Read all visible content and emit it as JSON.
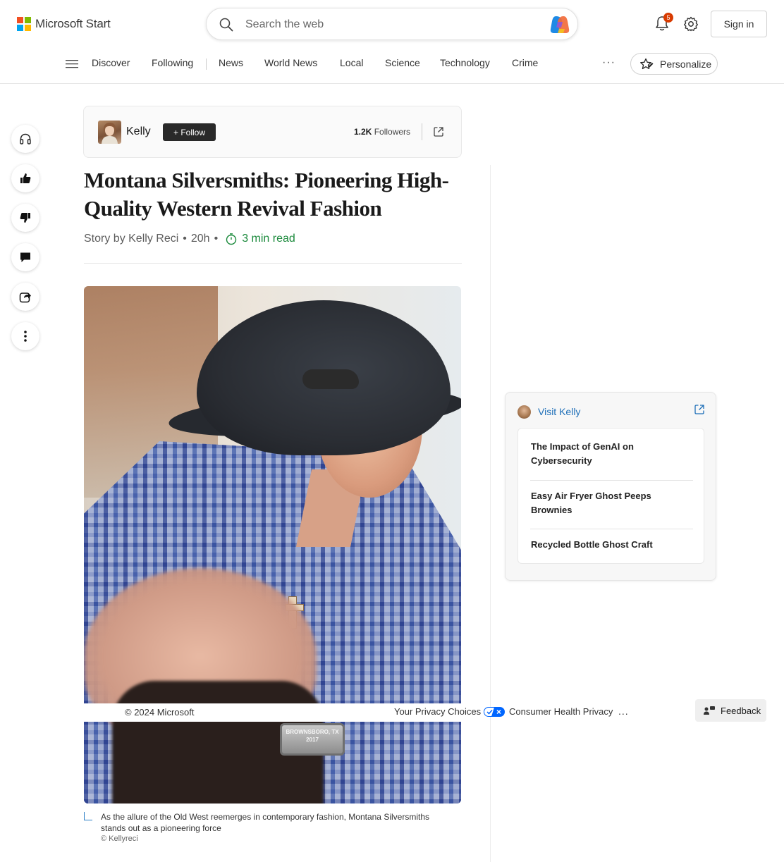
{
  "header": {
    "logo_text": "Microsoft Start",
    "logo_colors": [
      "#f25022",
      "#7fba00",
      "#00a4ef",
      "#ffb900"
    ],
    "search_placeholder": "Search the web",
    "notification_count": "5",
    "sign_in_label": "Sign in"
  },
  "nav": {
    "items": [
      "Discover",
      "Following",
      "News",
      "World News",
      "Local",
      "Science",
      "Technology",
      "Crime"
    ],
    "more_label": "···",
    "personalize_label": "Personalize"
  },
  "rail": {
    "icons": [
      "headphones-icon",
      "thumbs-up-icon",
      "thumbs-down-icon",
      "comment-icon",
      "share-icon",
      "more-vertical-icon"
    ]
  },
  "author_card": {
    "name": "Kelly",
    "follow_label": "Follow",
    "followers_count": "1.2K",
    "followers_label": "Followers"
  },
  "article": {
    "headline": "Montana Silversmiths: Pioneering High-Quality Western Revival Fashion",
    "story_by": "Story by Kelly Reci",
    "age": "20h",
    "read_time": "3 min read",
    "image_buckle_text": "BROWNSBORO, TX 2017",
    "caption": "As the allure of the Old West reemerges in contemporary fashion, Montana Silversmiths stands out as a pioneering force",
    "credit": "© Kellyreci"
  },
  "footer": {
    "copyright": "© 2024 Microsoft",
    "privacy_choices": "Your Privacy Choices",
    "consumer_health": "Consumer Health Privacy",
    "more": "...",
    "feedback_label": "Feedback"
  },
  "visit_card": {
    "label": "Visit Kelly",
    "items": [
      "The Impact of GenAI on Cybersecurity",
      "Easy Air Fryer Ghost Peeps Brownies",
      "Recycled Bottle Ghost Craft"
    ]
  },
  "colors": {
    "accent_link": "#1e6fb8",
    "read_time_green": "#1b8a3c",
    "badge_red": "#d83b01"
  }
}
